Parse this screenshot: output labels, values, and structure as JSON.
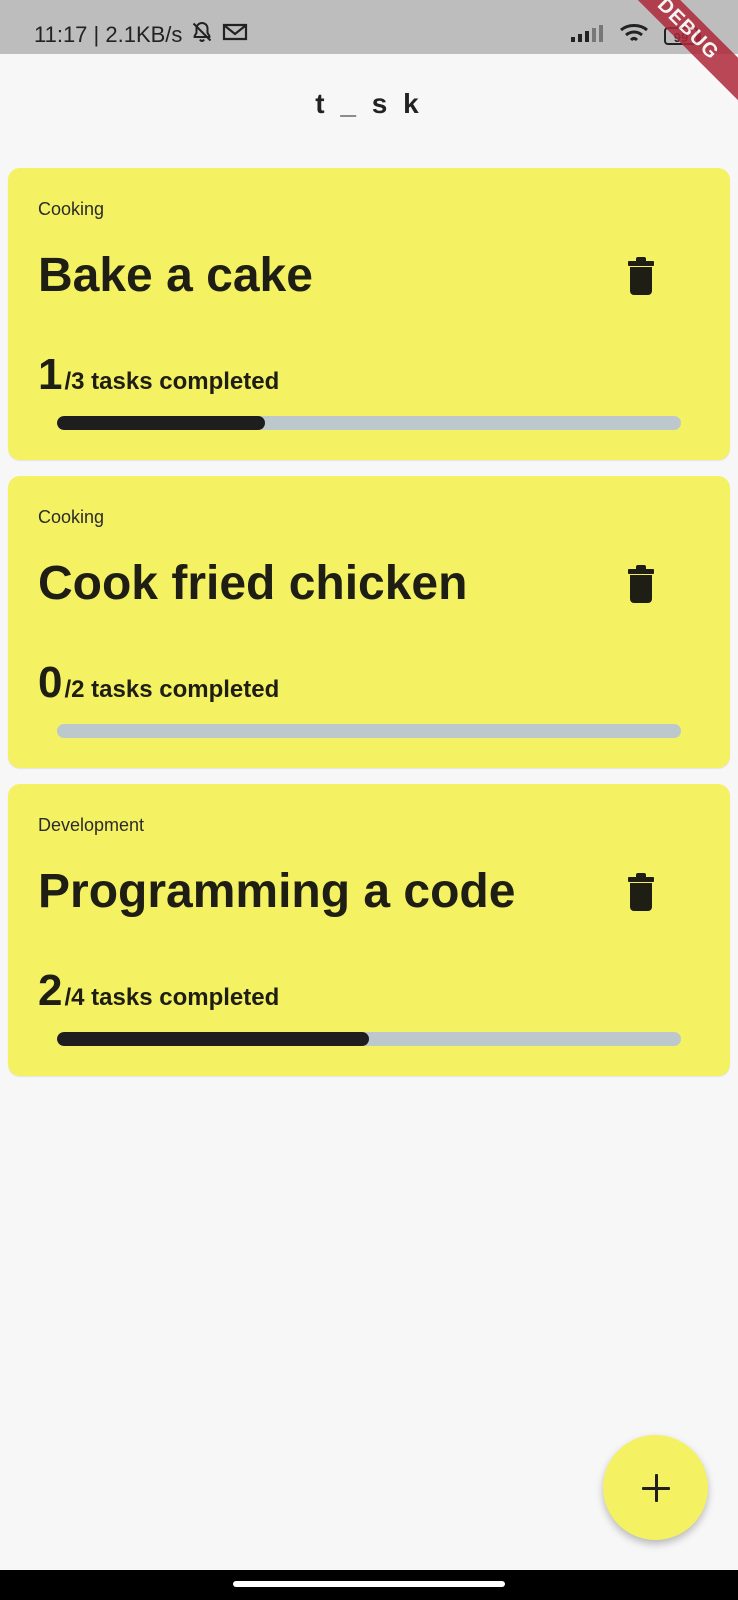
{
  "status_bar": {
    "time_speed": "11:17 | 2.1KB/s",
    "mail_icon": "mail-icon",
    "muted_bell_icon": "muted-bell-icon",
    "signal_icon": "signal-icon",
    "wifi_icon": "wifi-icon",
    "battery_level": "99",
    "debug_label": "DEBUG"
  },
  "app_bar": {
    "title": "t _ s k"
  },
  "tasks": [
    {
      "category": "Cooking",
      "title": "Bake a cake",
      "completed": "1",
      "summary": "/3 tasks completed",
      "progress": 0.333
    },
    {
      "category": "Cooking",
      "title": "Cook fried chicken",
      "completed": "0",
      "summary": "/2 tasks completed",
      "progress": 0
    },
    {
      "category": "Development",
      "title": "Programming a code",
      "completed": "2",
      "summary": "/4 tasks completed",
      "progress": 0.5
    }
  ],
  "fab": {
    "icon": "plus-icon"
  },
  "colors": {
    "accent": "#f4f162",
    "text": "#1e1e14",
    "track": "#bcc8cc",
    "fill": "#1e1e1e"
  }
}
